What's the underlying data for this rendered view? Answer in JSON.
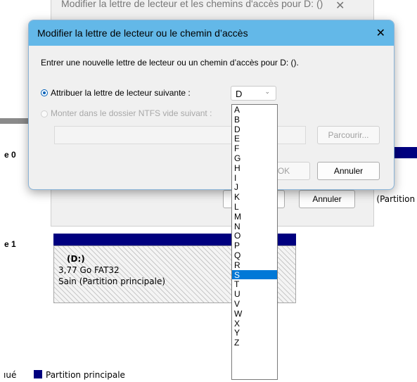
{
  "background": {
    "disk0_label": "e 0",
    "disk1_label": "e 1",
    "behind_dialog": {
      "title": "Modifier la lettre de lecteur et les chemins d'accès pour D: ()",
      "cancel_label": "Annuler"
    },
    "partition_right_label": "n (Partition",
    "volume": {
      "name": "(D:)",
      "size": "3,77 Go FAT32",
      "status": "Sain (Partition principale)"
    },
    "legend": {
      "unallocated_partial": "ıué",
      "primary_label": "Partition principale",
      "primary_color": "#00007f"
    }
  },
  "dialog": {
    "title": "Modifier la lettre de lecteur ou le chemin d’accès",
    "instruction": "Entrer une nouvelle lettre de lecteur ou un chemin d’accès pour D: ().",
    "assign_option_label": "Attribuer la lettre de lecteur suivante :",
    "mount_option_label": "Monter dans le dossier NTFS vide suivant :",
    "selected_letter": "D",
    "browse_label": "Parcourir...",
    "ok_label": "OK",
    "cancel_label": "Annuler",
    "titlebar_color": "#63b8e8"
  },
  "dropdown": {
    "options": [
      "A",
      "B",
      "D",
      "E",
      "F",
      "G",
      "H",
      "I",
      "J",
      "K",
      "L",
      "M",
      "N",
      "O",
      "P",
      "Q",
      "R",
      "S",
      "T",
      "U",
      "V",
      "W",
      "X",
      "Y",
      "Z"
    ],
    "highlighted": "S",
    "highlight_color": "#0078d7"
  }
}
